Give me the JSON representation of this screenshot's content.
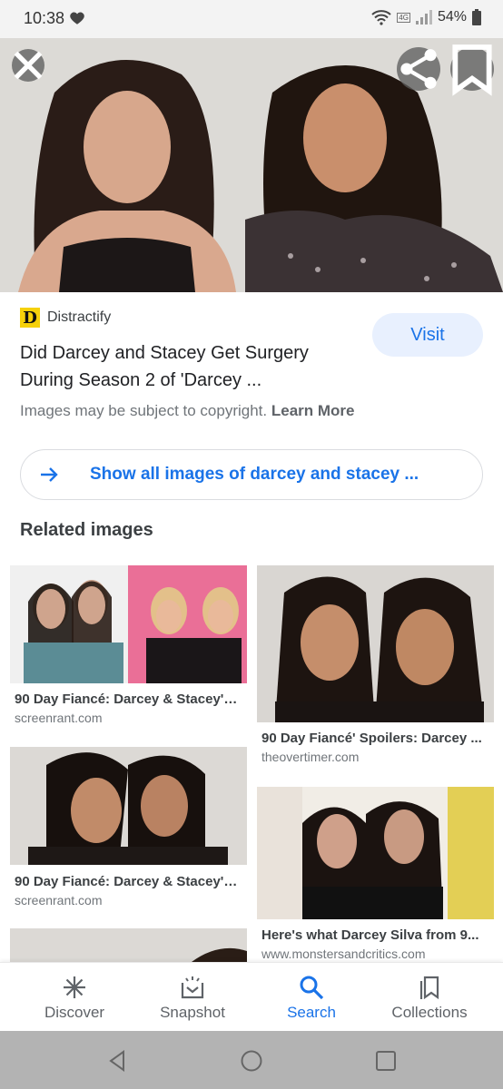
{
  "status_bar": {
    "time": "10:38",
    "lte_badge": "4G",
    "battery": "54%"
  },
  "hero": {
    "close_icon": "close-icon",
    "share_icon": "share-icon",
    "bookmark_icon": "bookmark-icon"
  },
  "result": {
    "source_logo_letter": "D",
    "source_name": "Distractify",
    "title": "Did Darcey and Stacey Get Surgery During Season 2 of 'Darcey ...",
    "visit_label": "Visit",
    "copyright_text": "Images may be subject to copyright.",
    "learn_more": "Learn More"
  },
  "show_all": {
    "label": "Show all images of darcey and stacey ..."
  },
  "related": {
    "heading": "Related images",
    "items": [
      {
        "title": "90 Day Fiancé: Darcey & Stacey's ...",
        "site": "screenrant.com"
      },
      {
        "title": "90 Day Fiancé' Spoilers: Darcey ...",
        "site": "theovertimer.com"
      },
      {
        "title": "90 Day Fiancé: Darcey & Stacey's ...",
        "site": "screenrant.com"
      },
      {
        "title": "Here's what Darcey Silva from 9...",
        "site": "www.monstersandcritics.com"
      }
    ]
  },
  "bottom_nav": {
    "items": [
      {
        "label": "Discover",
        "icon": "asterisk-icon"
      },
      {
        "label": "Snapshot",
        "icon": "snapshot-icon"
      },
      {
        "label": "Search",
        "icon": "search-icon",
        "active": true
      },
      {
        "label": "Collections",
        "icon": "collections-icon"
      }
    ]
  },
  "colors": {
    "accent": "#1a73e8",
    "visit_bg": "#e8f0fe",
    "logo_yellow": "#f6d10a"
  }
}
